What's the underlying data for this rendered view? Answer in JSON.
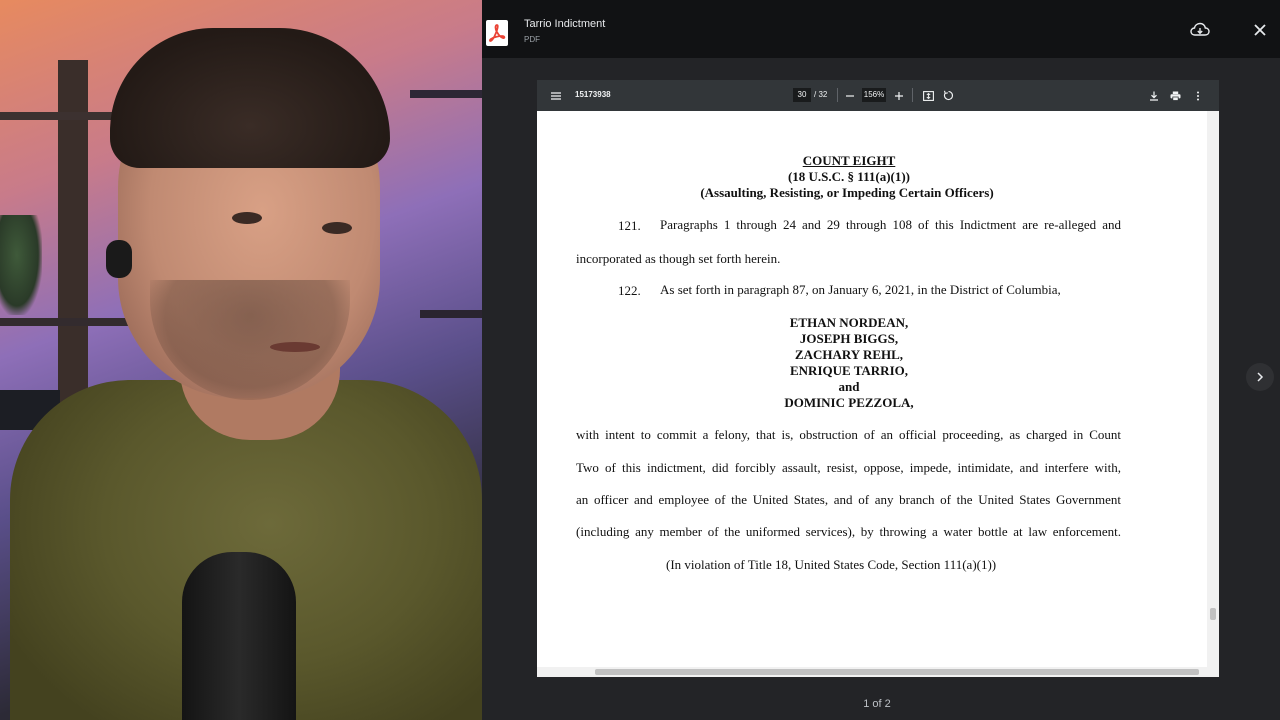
{
  "viewer": {
    "file_title": "Tarrio Indictment",
    "file_type": "PDF",
    "pager": "1 of 2"
  },
  "pdf_toolbar": {
    "doc_id": "15173938",
    "current_page": "30",
    "total_pages": "/ 32",
    "zoom": "156%"
  },
  "document": {
    "count_title": "COUNT EIGHT",
    "statute": "(18 U.S.C. § 111(a)(1))",
    "offense": "(Assaulting, Resisting, or Impeding Certain Officers)",
    "para121_num": "121.",
    "para121_line1": "Paragraphs 1 through 24 and 29 through 108 of this Indictment are re-alleged and",
    "para121_line2": "incorporated as though set forth herein.",
    "para122_num": "122.",
    "para122_line1": "As set forth in paragraph 87, on January 6, 2021, in the District of Columbia,",
    "defendants": [
      "ETHAN NORDEAN,",
      "JOSEPH BIGGS,",
      "ZACHARY REHL,",
      "ENRIQUE TARRIO,",
      "and",
      "DOMINIC PEZZOLA,"
    ],
    "body_lines": [
      "with intent to commit a felony, that is, obstruction of an official proceeding, as charged in Count",
      "Two of this indictment, did forcibly assault, resist, oppose, impede, intimidate, and interfere with,",
      "an officer and employee of the United States, and of any branch of the United States Government",
      "(including any member of the uniformed services), by throwing a water bottle at law enforcement."
    ],
    "violation": "(In violation of Title 18, United States Code, Section 111(a)(1))"
  },
  "colors": {
    "topbar": "#111214",
    "pdf_toolbar": "#323639",
    "pdf_icon_red": "#ea4335"
  },
  "icons": {
    "menu": "menu-icon",
    "zoom_out": "minus-icon",
    "zoom_in": "plus-icon",
    "fit": "fit-page-icon",
    "rotate": "rotate-icon",
    "download": "download-icon",
    "print": "print-icon",
    "more": "more-vert-icon",
    "save_to_drive": "cloud-download-icon",
    "close": "close-icon",
    "next": "chevron-right-icon"
  }
}
